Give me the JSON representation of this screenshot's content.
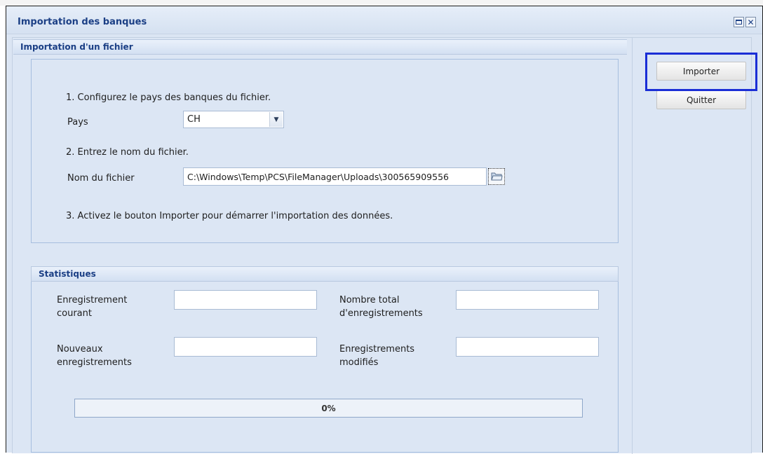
{
  "window": {
    "title": "Importation des banques"
  },
  "import_section": {
    "header": "Importation d'un fichier",
    "step1": "1.  Configurez le pays des banques du fichier.",
    "country_label": "Pays",
    "country_value": "CH",
    "step2": "2.  Entrez le nom du fichier.",
    "filename_label": "Nom du fichier",
    "filename_value": "C:\\Windows\\Temp\\PCS\\FileManager\\Uploads\\300565909556",
    "step3": "3.  Activez le bouton Importer pour démarrer l'importation des données."
  },
  "stats_section": {
    "header": "Statistiques",
    "current_record_label_1": "Enregistrement",
    "current_record_label_2": "courant",
    "current_record_value": "",
    "total_records_label_1": "Nombre total",
    "total_records_label_2": "d'enregistrements",
    "total_records_value": "",
    "new_records_label_1": "Nouveaux",
    "new_records_label_2": "enregistrements",
    "new_records_value": "",
    "modified_records_label_1": "Enregistrements",
    "modified_records_label_2": "modifiés",
    "modified_records_value": "",
    "progress_label": "0%",
    "progress_percent": 0
  },
  "actions": {
    "import_label": "Importer",
    "quit_label": "Quitter"
  },
  "icons": {
    "maximize": "maximize-icon",
    "close": "close-icon",
    "dropdown": "chevron-down-icon",
    "browse": "folder-icon"
  },
  "colors": {
    "title_text": "#1b3f85",
    "panel_bg": "#dce6f4",
    "highlight_border": "#1a2ed6"
  }
}
